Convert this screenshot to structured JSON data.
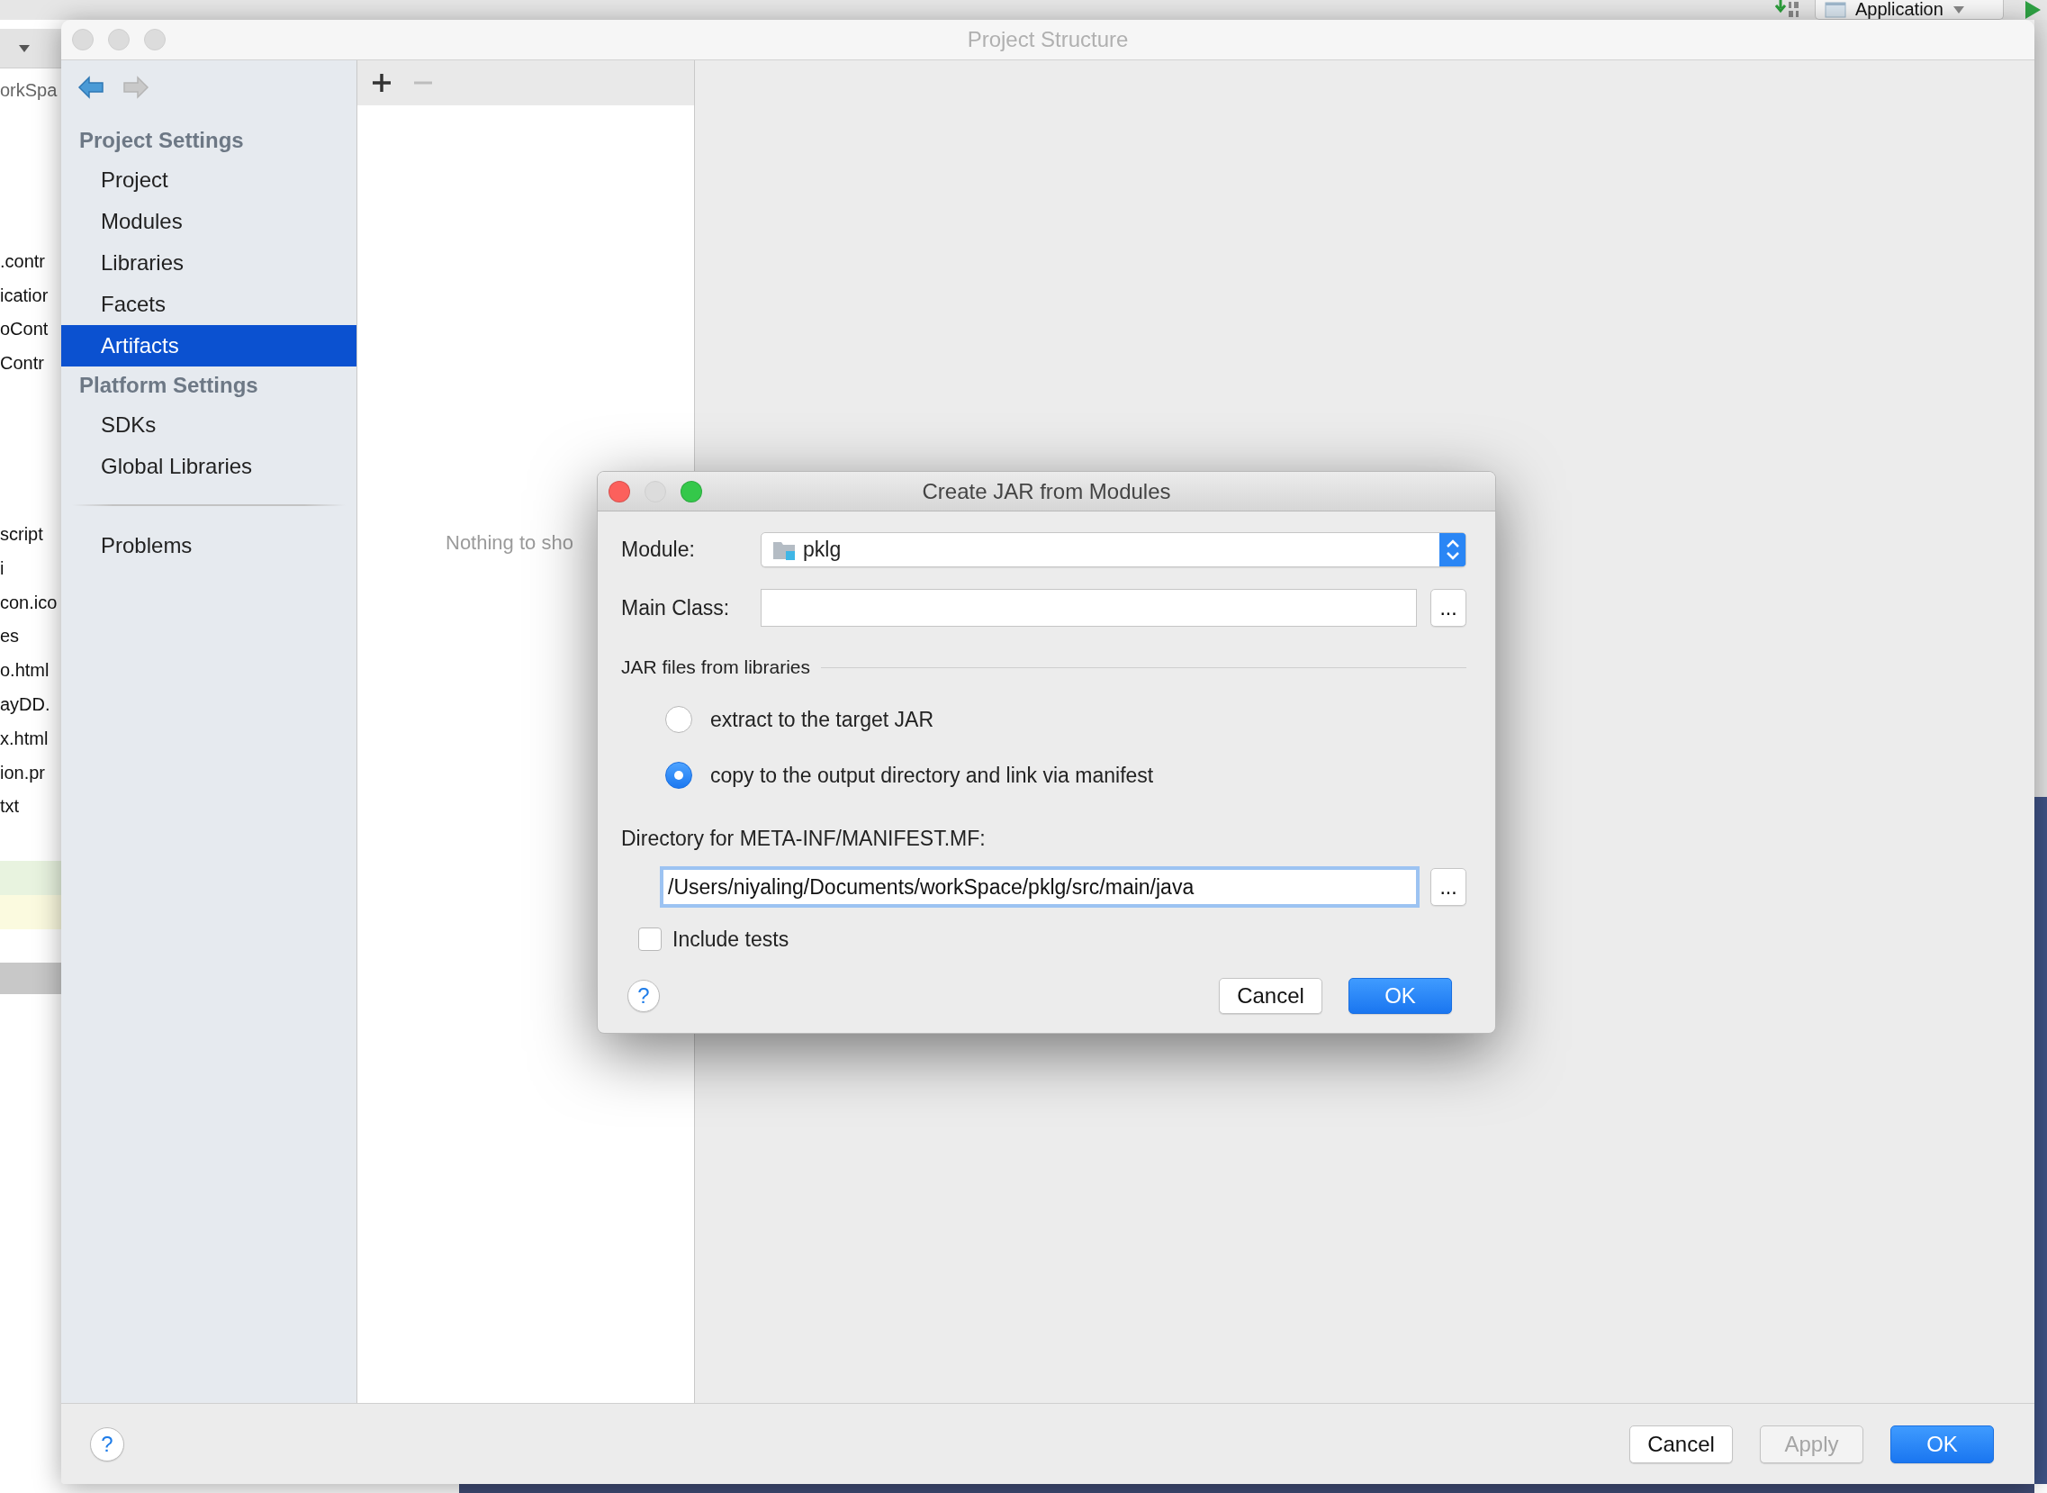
{
  "ide": {
    "toolbar": {
      "run_configuration": "Application"
    },
    "file_tree": {
      "header_item": "orkSpa",
      "groups": [
        {
          "items": [
            ".contr",
            "icatior",
            "oCont",
            "Contr"
          ]
        },
        {
          "items": [
            "script",
            "i",
            "con.ico",
            "es",
            "o.html",
            "ayDD.",
            "x.html",
            "ion.pr",
            "txt"
          ]
        }
      ]
    }
  },
  "window": {
    "title": "Project Structure",
    "active": false,
    "nav": [
      {
        "kind": "back",
        "disabled": false
      },
      {
        "kind": "forward",
        "disabled": true
      }
    ],
    "sidebar": {
      "sections": [
        {
          "heading": "Project Settings",
          "items": [
            {
              "label": "Project",
              "selected": false
            },
            {
              "label": "Modules",
              "selected": false
            },
            {
              "label": "Libraries",
              "selected": false
            },
            {
              "label": "Facets",
              "selected": false
            },
            {
              "label": "Artifacts",
              "selected": true
            }
          ]
        },
        {
          "heading": "Platform Settings",
          "items": [
            {
              "label": "SDKs",
              "selected": false
            },
            {
              "label": "Global Libraries",
              "selected": false
            }
          ]
        }
      ],
      "extra_items": [
        {
          "label": "Problems",
          "selected": false
        }
      ]
    },
    "list_panel": {
      "tools": [
        {
          "kind": "add",
          "disabled": false
        },
        {
          "kind": "remove",
          "disabled": true
        }
      ],
      "empty_text": "Nothing to sho"
    },
    "footer": {
      "help": "?",
      "buttons": [
        {
          "label": "Cancel",
          "kind": "default",
          "disabled": false
        },
        {
          "label": "Apply",
          "kind": "default",
          "disabled": true
        },
        {
          "label": "OK",
          "kind": "primary",
          "disabled": false
        }
      ]
    }
  },
  "dialog": {
    "title": "Create JAR from Modules",
    "active": true,
    "traffic_lights": [
      {
        "kind": "close",
        "disabled": false
      },
      {
        "kind": "minimize",
        "disabled": true
      },
      {
        "kind": "zoom",
        "disabled": false
      }
    ],
    "module": {
      "label": "Module:",
      "value": "pklg"
    },
    "main_class": {
      "label": "Main Class:",
      "browse": "..."
    },
    "libraries": {
      "heading": "JAR files from libraries",
      "options": [
        {
          "label": "extract to the target JAR",
          "selected": false
        },
        {
          "label": "copy to the output directory and link via manifest",
          "selected": true
        }
      ]
    },
    "manifest_dir": {
      "label": "Directory for META-INF/MANIFEST.MF:",
      "value": "/Users/niyaling/Documents/workSpace/pklg/src/main/java",
      "focused": true,
      "browse": "..."
    },
    "include_tests": {
      "label": "Include tests",
      "checked": false
    },
    "help": "?",
    "buttons": [
      {
        "label": "Cancel",
        "kind": "default",
        "disabled": false
      },
      {
        "label": "OK",
        "kind": "primary",
        "disabled": false
      }
    ]
  }
}
